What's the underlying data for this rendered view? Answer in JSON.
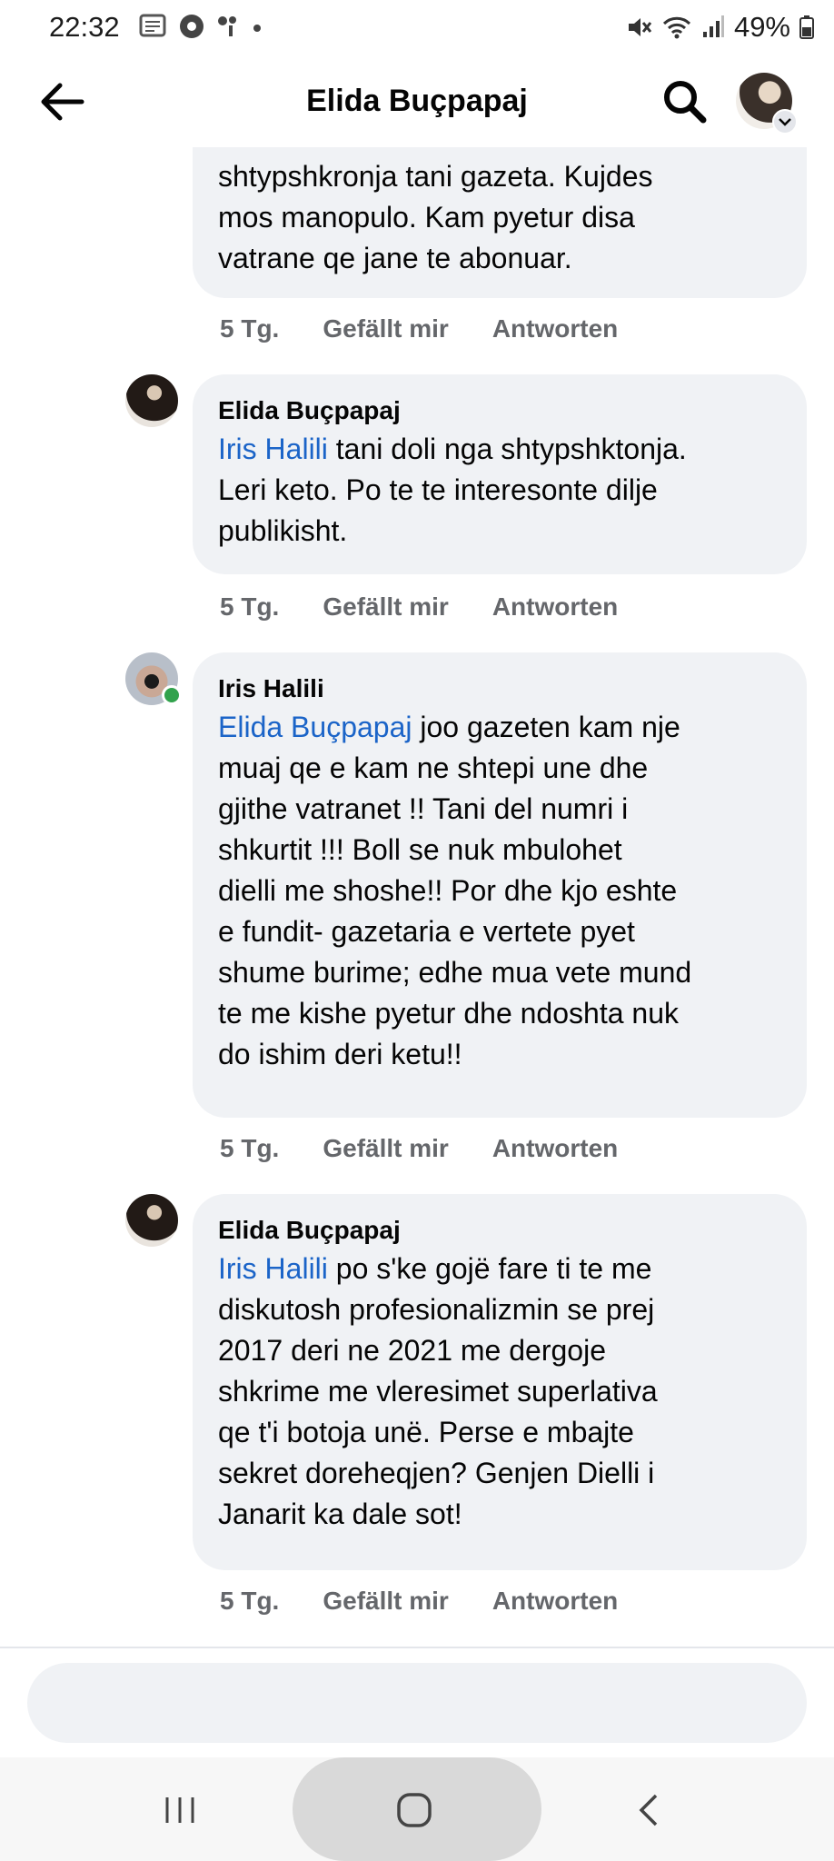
{
  "status_bar": {
    "time": "22:32",
    "battery": "49%",
    "icons": [
      "news-icon",
      "chrome-icon",
      "notification-icon",
      "dot-icon",
      "mute-icon",
      "wifi-icon",
      "signal-icon",
      "battery-icon"
    ]
  },
  "header": {
    "title": "Elida Buçpapaj"
  },
  "comments": [
    {
      "author": "",
      "mention": "",
      "text_lines": [
        "shtypshkronja tani gazeta. Kujdes",
        "mos manopulo. Kam pyetur disa",
        "vatrane qe jane te abonuar."
      ],
      "time": "5 Tg.",
      "like": "Gefällt mir",
      "reply": "Antworten"
    },
    {
      "author": "Elida Buçpapaj",
      "mention": "Iris Halili",
      "first_rest": " tani doli nga shtypshktonja.",
      "text_lines": [
        "Leri keto. Po te te interesonte dilje",
        "publikisht."
      ],
      "time": "5 Tg.",
      "like": "Gefällt mir",
      "reply": "Antworten"
    },
    {
      "author": "Iris Halili",
      "mention": "Elida Buçpapaj",
      "first_rest": " joo gazeten kam nje",
      "text_lines": [
        "muaj qe e kam ne shtepi une dhe",
        "gjithe vatranet !! Tani del numri i",
        "shkurtit !!! Boll se nuk mbulohet",
        "dielli me shoshe!! Por dhe kjo eshte",
        "e fundit- gazetaria e vertete pyet",
        "shume burime; edhe mua vete mund",
        "te me kishe pyetur dhe ndoshta nuk",
        "do ishim deri ketu!!"
      ],
      "time": "5 Tg.",
      "like": "Gefällt mir",
      "reply": "Antworten"
    },
    {
      "author": "Elida Buçpapaj",
      "mention": "Iris Halili",
      "first_rest": " po s'ke gojë fare ti te me",
      "text_lines": [
        "diskutosh profesionalizmin se prej",
        "2017 deri ne 2021 me dergoje",
        "shkrime me vleresimet superlativa",
        "qe t'i botoja unë. Perse e mbajte",
        "sekret doreheqjen? Genjen Dielli i",
        "Janarit ka dale sot!"
      ],
      "time": "5 Tg.",
      "like": "Gefällt mir",
      "reply": "Antworten"
    }
  ],
  "reply_box": {
    "placeholder": ""
  },
  "colors": {
    "bubble": "#f0f2f5",
    "mention": "#1b64c8",
    "meta": "#65676b",
    "online": "#31a24c"
  }
}
